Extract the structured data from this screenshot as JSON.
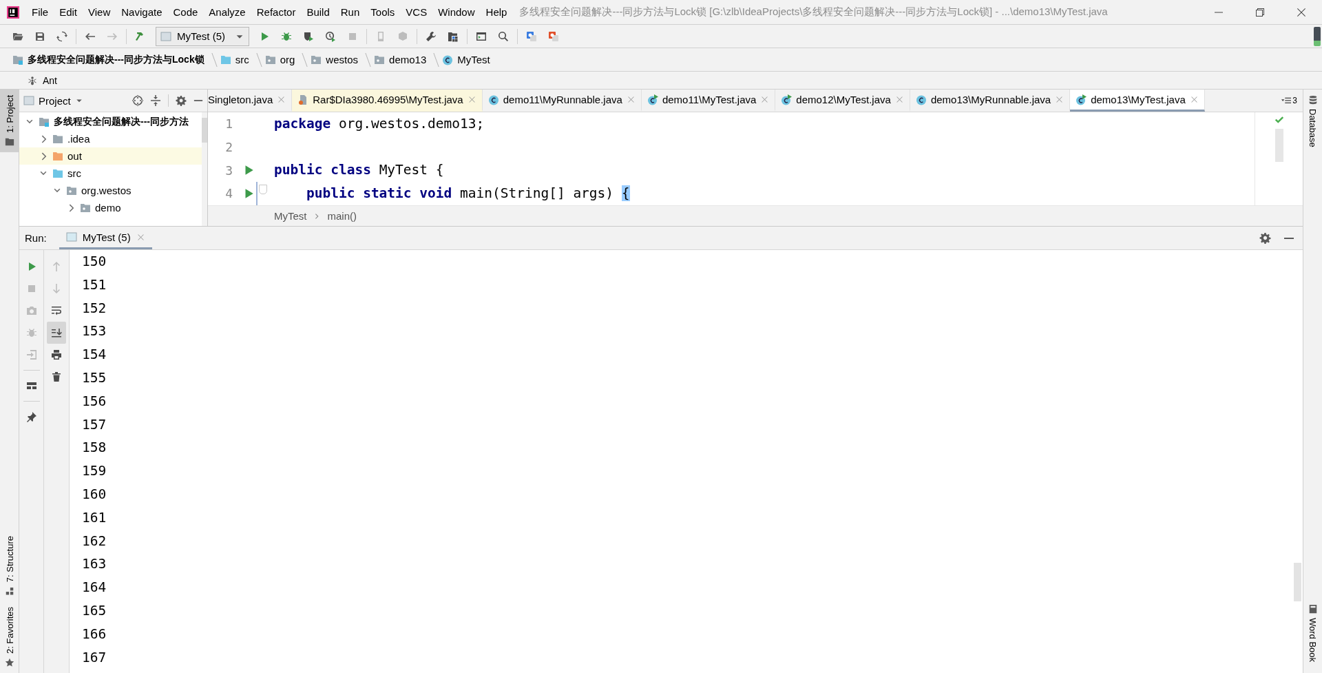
{
  "window": {
    "title": "多线程安全问题解决---同步方法与Lock锁 [G:\\zlb\\IdeaProjects\\多线程安全问题解决---同步方法与Lock锁] - ...\\demo13\\MyTest.java"
  },
  "menu": [
    "File",
    "Edit",
    "View",
    "Navigate",
    "Code",
    "Analyze",
    "Refactor",
    "Build",
    "Run",
    "Tools",
    "VCS",
    "Window",
    "Help"
  ],
  "toolbar": [
    {
      "kind": "open",
      "disabled": false
    },
    {
      "kind": "save",
      "disabled": false
    },
    {
      "kind": "sync",
      "disabled": false
    },
    {
      "kind": "separator"
    },
    {
      "kind": "back",
      "disabled": false
    },
    {
      "kind": "forward",
      "disabled": true
    },
    {
      "kind": "separator"
    },
    {
      "kind": "build",
      "disabled": false
    },
    {
      "kind": "config",
      "label": "MyTest (5)"
    },
    {
      "kind": "run",
      "disabled": false
    },
    {
      "kind": "debug",
      "disabled": false
    },
    {
      "kind": "coverage",
      "disabled": false
    },
    {
      "kind": "profile",
      "disabled": false
    },
    {
      "kind": "stop",
      "disabled": true
    },
    {
      "kind": "separator"
    },
    {
      "kind": "device",
      "disabled": true
    },
    {
      "kind": "cubes",
      "disabled": true
    },
    {
      "kind": "separator"
    },
    {
      "kind": "wrench",
      "disabled": false
    },
    {
      "kind": "structure",
      "disabled": false
    },
    {
      "kind": "separator"
    },
    {
      "kind": "terminal",
      "disabled": false
    },
    {
      "kind": "search",
      "disabled": false
    },
    {
      "kind": "separator"
    },
    {
      "kind": "translate-blue",
      "disabled": false
    },
    {
      "kind": "translate-red",
      "disabled": false
    }
  ],
  "navigation_bar": [
    {
      "label": "多线程安全问题解决---同步方法与Lock锁",
      "kind": "module"
    },
    {
      "label": "src",
      "kind": "source"
    },
    {
      "label": "org",
      "kind": "package"
    },
    {
      "label": "westos",
      "kind": "package"
    },
    {
      "label": "demo13",
      "kind": "package"
    },
    {
      "label": "MyTest",
      "kind": "class"
    }
  ],
  "ant_bar": {
    "label": "Ant"
  },
  "left_stripe": {
    "top": [
      {
        "label": "1: Project",
        "selected": true
      }
    ],
    "bottom": [
      {
        "label": "7: Structure",
        "selected": false
      },
      {
        "label": "2: Favorites",
        "selected": false
      }
    ]
  },
  "project_panel": {
    "title": "Project",
    "tree": [
      {
        "label": "多线程安全问题解决---同步方法",
        "kind": "module",
        "expanded": true,
        "children": [
          {
            "label": ".idea",
            "kind": "folder",
            "expanded": false
          },
          {
            "label": "out",
            "kind": "excluded",
            "expanded": false
          },
          {
            "label": "src",
            "kind": "source",
            "expanded": true,
            "children": [
              {
                "label": "org.westos",
                "kind": "package",
                "expanded": true,
                "children": [
                  {
                    "label": "demo",
                    "kind": "package",
                    "expanded": false
                  }
                ]
              }
            ]
          }
        ]
      }
    ]
  },
  "editor": {
    "tabs": [
      {
        "label": "Singleton.java",
        "kind": "cut",
        "selected": false
      },
      {
        "label": "Rar$DIa3980.46995\\MyTest.java",
        "kind": "archive",
        "selected": false
      },
      {
        "label": "demo11\\MyRunnable.java",
        "kind": "class",
        "selected": false
      },
      {
        "label": "demo11\\MyTest.java",
        "kind": "runnable",
        "selected": false
      },
      {
        "label": "demo12\\MyTest.java",
        "kind": "runnable",
        "selected": false
      },
      {
        "label": "demo13\\MyRunnable.java",
        "kind": "class",
        "selected": false
      },
      {
        "label": "demo13\\MyTest.java",
        "kind": "runnable",
        "selected": true
      }
    ],
    "tab_count": "3",
    "lines": [
      {
        "number": "1",
        "run": false,
        "fold": false,
        "tokens": [
          {
            "text": "package",
            "kind": "keyword"
          },
          {
            "text": " org.westos.demo13;",
            "kind": "plain"
          }
        ]
      },
      {
        "number": "2",
        "run": false,
        "fold": false
      },
      {
        "number": "3",
        "run": true,
        "fold": false,
        "tokens": [
          {
            "text": "public class",
            "kind": "keyword"
          },
          {
            "text": " MyTest {",
            "kind": "plain"
          }
        ]
      },
      {
        "number": "4",
        "run": true,
        "fold": true,
        "tokens": [
          {
            "text": "    public static void",
            "kind": "keyword"
          },
          {
            "text": " main(String[] args) ",
            "kind": "plain"
          },
          {
            "text": "{",
            "kind": "brace-match"
          }
        ]
      }
    ],
    "breadcrumbs": [
      "MyTest",
      "main()"
    ]
  },
  "run_panel": {
    "label": "Run:",
    "tabs": [
      {
        "label": "MyTest (5)",
        "selected": true
      }
    ],
    "actions": [
      {
        "kind": "rerun",
        "disabled": false
      },
      {
        "kind": "stop",
        "disabled": true
      },
      {
        "kind": "camera",
        "disabled": true
      },
      {
        "kind": "debug",
        "disabled": true
      },
      {
        "kind": "exit",
        "disabled": true
      },
      {
        "kind": "separator"
      },
      {
        "kind": "layout",
        "disabled": false
      },
      {
        "kind": "separator"
      },
      {
        "kind": "pin",
        "disabled": false
      }
    ],
    "output_actions": [
      {
        "kind": "up",
        "pressed": false,
        "disabled": true
      },
      {
        "kind": "down",
        "pressed": false,
        "disabled": true
      },
      {
        "kind": "wrap",
        "pressed": false,
        "disabled": false
      },
      {
        "kind": "scroll-end",
        "pressed": true,
        "disabled": false
      },
      {
        "kind": "print",
        "pressed": false,
        "disabled": false
      },
      {
        "kind": "trash",
        "pressed": false,
        "disabled": false
      }
    ],
    "output": [
      "150",
      "151",
      "152",
      "153",
      "154",
      "155",
      "156",
      "157",
      "158",
      "159",
      "160",
      "161",
      "162",
      "163",
      "164",
      "165",
      "166",
      "167"
    ]
  },
  "right_stripe": [
    {
      "label": "Database",
      "kind": "database"
    },
    {
      "label": "Word Book",
      "kind": "book"
    }
  ]
}
